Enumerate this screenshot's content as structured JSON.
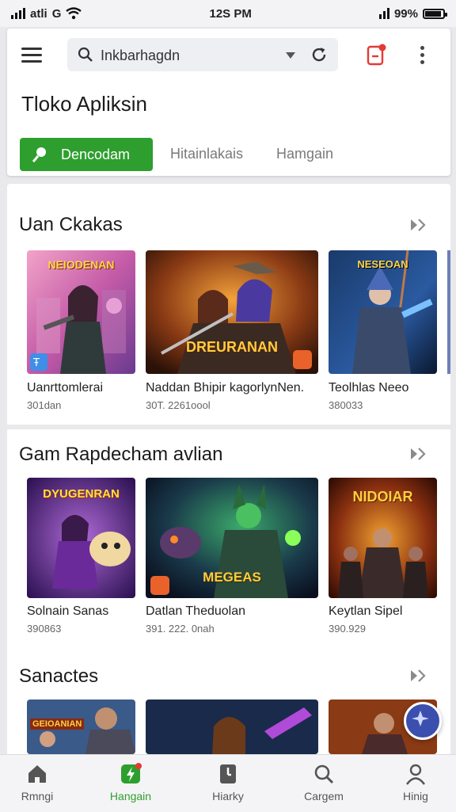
{
  "status": {
    "carrier": "atli",
    "carrier_suffix": "G",
    "time": "12S PM",
    "battery": "99%"
  },
  "header": {
    "search_value": "Inkbarhagdn",
    "title": "Tloko Apliksin",
    "tabs": [
      {
        "label": "Dencodam",
        "active": true
      },
      {
        "label": "Hitainlakais",
        "active": false
      },
      {
        "label": "Hamgain",
        "active": false
      }
    ]
  },
  "sections": [
    {
      "title": "Uan Ckakas",
      "apps": [
        {
          "art_title": "NEIODENAN",
          "name": "Uanrttomlerai",
          "meta": "301dan"
        },
        {
          "art_title": "DREURANAN",
          "name": "Naddan Bhipir kagorlynNen.",
          "meta": "30T. 2261oool"
        },
        {
          "art_title": "NESEOAN",
          "name": "Teolhlas Neeo",
          "meta": "380033"
        }
      ]
    },
    {
      "title": "Gam Rapdecham avlian",
      "apps": [
        {
          "art_title": "DYUGENRAN",
          "name": "Solnain Sanas",
          "meta": "390863"
        },
        {
          "art_title": "MEGEAS",
          "name": "Datlan Theduolan",
          "meta": "391. 222. 0nah"
        },
        {
          "art_title": "NIDOIAR",
          "name": "Keytlan Sipel",
          "meta": "390.929"
        }
      ]
    },
    {
      "title": "Sanactes",
      "apps": [
        {
          "art_title": "GEIOANIAN",
          "name": "",
          "meta": ""
        },
        {
          "art_title": "",
          "name": "",
          "meta": ""
        },
        {
          "art_title": "",
          "name": "",
          "meta": ""
        }
      ]
    }
  ],
  "bottom_nav": [
    {
      "label": "Rmngi",
      "icon": "home-icon",
      "active": false
    },
    {
      "label": "Hangain",
      "icon": "bolt-icon",
      "active": true
    },
    {
      "label": "Hiarky",
      "icon": "clock-icon",
      "active": false
    },
    {
      "label": "Cargem",
      "icon": "search-icon",
      "active": false
    },
    {
      "label": "Hinig",
      "icon": "person-icon",
      "active": false
    }
  ],
  "colors": {
    "accent_green": "#2e9f2e",
    "notify_red": "#e53935"
  }
}
